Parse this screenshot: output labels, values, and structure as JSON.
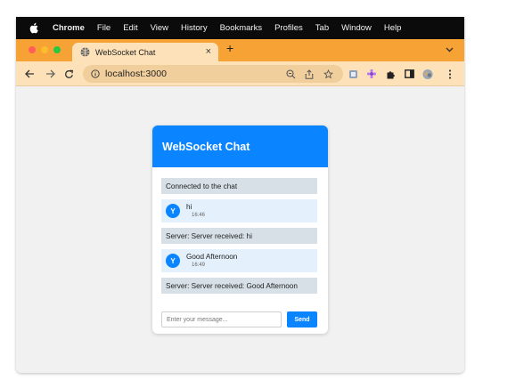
{
  "menubar": {
    "apple_icon": "apple-logo-icon",
    "items": [
      "Chrome",
      "File",
      "Edit",
      "View",
      "History",
      "Bookmarks",
      "Profiles",
      "Tab",
      "Window",
      "Help"
    ]
  },
  "browser": {
    "accent_color": "#f7a235",
    "tab": {
      "title": "WebSocket Chat",
      "close_glyph": "×",
      "favicon": "globe-icon"
    },
    "new_tab_glyph": "+",
    "address": "localhost:3000",
    "toolbar_icons": [
      "back-arrow-icon",
      "forward-arrow-icon",
      "reload-icon",
      "zoom-icon",
      "share-icon",
      "bookmark-star-icon",
      "extension-icons",
      "puzzle-icon",
      "sidebar-icon",
      "profile-avatar-icon",
      "more-menu-icon"
    ]
  },
  "chat": {
    "title": "WebSocket Chat",
    "header_color": "#0a84ff",
    "messages": [
      {
        "type": "system",
        "text": "Connected to the chat"
      },
      {
        "type": "user",
        "avatar": "Y",
        "text": "hi",
        "time": "16:46"
      },
      {
        "type": "system",
        "text": "Server: Server received: hi"
      },
      {
        "type": "user",
        "avatar": "Y",
        "text": "Good Afternoon",
        "time": "16:49"
      },
      {
        "type": "system",
        "text": "Server: Server received: Good Afternoon"
      }
    ],
    "input": {
      "placeholder": "Enter your message...",
      "value": ""
    },
    "send_label": "Send"
  }
}
